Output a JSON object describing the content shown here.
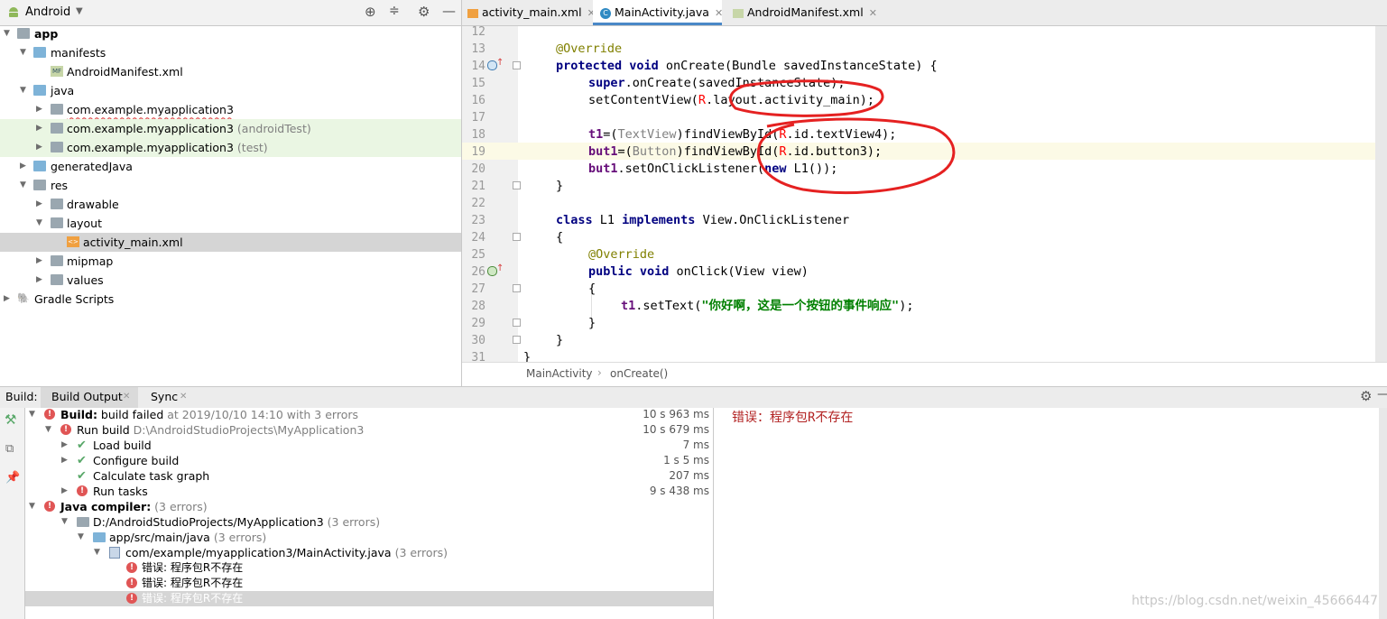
{
  "project_panel": {
    "view_selector": "Android",
    "tree": [
      {
        "label": "app",
        "bold": true
      },
      {
        "label": "manifests"
      },
      {
        "label": "AndroidManifest.xml"
      },
      {
        "label": "java"
      },
      {
        "label": "com.example.myapplication3",
        "suffix": ""
      },
      {
        "label": "com.example.myapplication3",
        "suffix": "(androidTest)"
      },
      {
        "label": "com.example.myapplication3",
        "suffix": "(test)"
      },
      {
        "label": "generatedJava"
      },
      {
        "label": "res"
      },
      {
        "label": "drawable"
      },
      {
        "label": "layout"
      },
      {
        "label": "activity_main.xml"
      },
      {
        "label": "mipmap"
      },
      {
        "label": "values"
      },
      {
        "label": "Gradle Scripts"
      }
    ]
  },
  "editor": {
    "tabs": [
      {
        "label": "activity_main.xml",
        "active": false
      },
      {
        "label": "MainActivity.java",
        "active": true
      },
      {
        "label": "AndroidManifest.xml",
        "active": false
      }
    ],
    "line_numbers": [
      "12",
      "13",
      "14",
      "15",
      "16",
      "17",
      "18",
      "19",
      "20",
      "21",
      "22",
      "23",
      "24",
      "25",
      "26",
      "27",
      "28",
      "29",
      "30",
      "31"
    ],
    "code": {
      "l13": "@Override",
      "l14_kw": "protected void",
      "l14_rest": " onCreate(Bundle savedInstanceState) {",
      "l15_kw": "super",
      "l15_rest": ".onCreate(savedInstanceState);",
      "l16_a": "setContentView(",
      "l16_r": "R",
      "l16_b": ".layout.activity_main);",
      "l18_fld": "t1",
      "l18_a": "=(",
      "l18_cast": "TextView",
      "l18_b": ")findViewById(",
      "l18_r": "R",
      "l18_c": ".id.textView4);",
      "l19_fld": "but1",
      "l19_a": "=(",
      "l19_cast": "Button",
      "l19_b": ")findViewById(",
      "l19_r": "R",
      "l19_c": ".id.button3);",
      "l20_fld": "but1",
      "l20_a": ".setOnClickListener(",
      "l20_kw": "new",
      "l20_b": " L1());",
      "l21": "}",
      "l23_kw1": "class",
      "l23_a": " L1 ",
      "l23_kw2": "implements",
      "l23_b": " View.OnClickListener",
      "l24": "{",
      "l25": "@Override",
      "l26_kw": "public void",
      "l26_rest": " onClick(View view)",
      "l27": "{",
      "l28_fld": "t1",
      "l28_a": ".setText(",
      "l28_str": "\"你好啊，这是一个按钮的事件响应\"",
      "l28_b": ");",
      "l29": "}",
      "l30": "}",
      "l31": "}"
    },
    "breadcrumb": [
      "MainActivity",
      "onCreate()"
    ]
  },
  "build": {
    "label": "Build:",
    "tabs": [
      "Build Output",
      "Sync"
    ],
    "rows": [
      {
        "bold": "Build:",
        "text": " build failed",
        "muted": " at 2019/10/10 14:10  with 3 errors",
        "time": "10 s 963 ms"
      },
      {
        "text": "Run build",
        "muted": " D:\\AndroidStudioProjects\\MyApplication3",
        "time": "10 s 679 ms"
      },
      {
        "text": "Load build",
        "time": "7 ms"
      },
      {
        "text": "Configure build",
        "time": "1 s 5 ms"
      },
      {
        "text": "Calculate task graph",
        "time": "207 ms"
      },
      {
        "text": "Run tasks",
        "time": "9 s 438 ms"
      },
      {
        "bold": "Java compiler:",
        "muted": "  (3 errors)"
      },
      {
        "text": "D:/AndroidStudioProjects/MyApplication3",
        "muted": "  (3 errors)"
      },
      {
        "text": "app/src/main/java",
        "muted": "  (3 errors)"
      },
      {
        "text": "com/example/myapplication3/MainActivity.java",
        "muted": "  (3 errors)"
      },
      {
        "text": "错误: 程序包R不存在"
      },
      {
        "text": "错误: 程序包R不存在"
      },
      {
        "text": "错误: 程序包R不存在"
      }
    ],
    "detail_message": "错误：程序包R不存在"
  },
  "watermark": "https://blog.csdn.net/weixin_45666447"
}
